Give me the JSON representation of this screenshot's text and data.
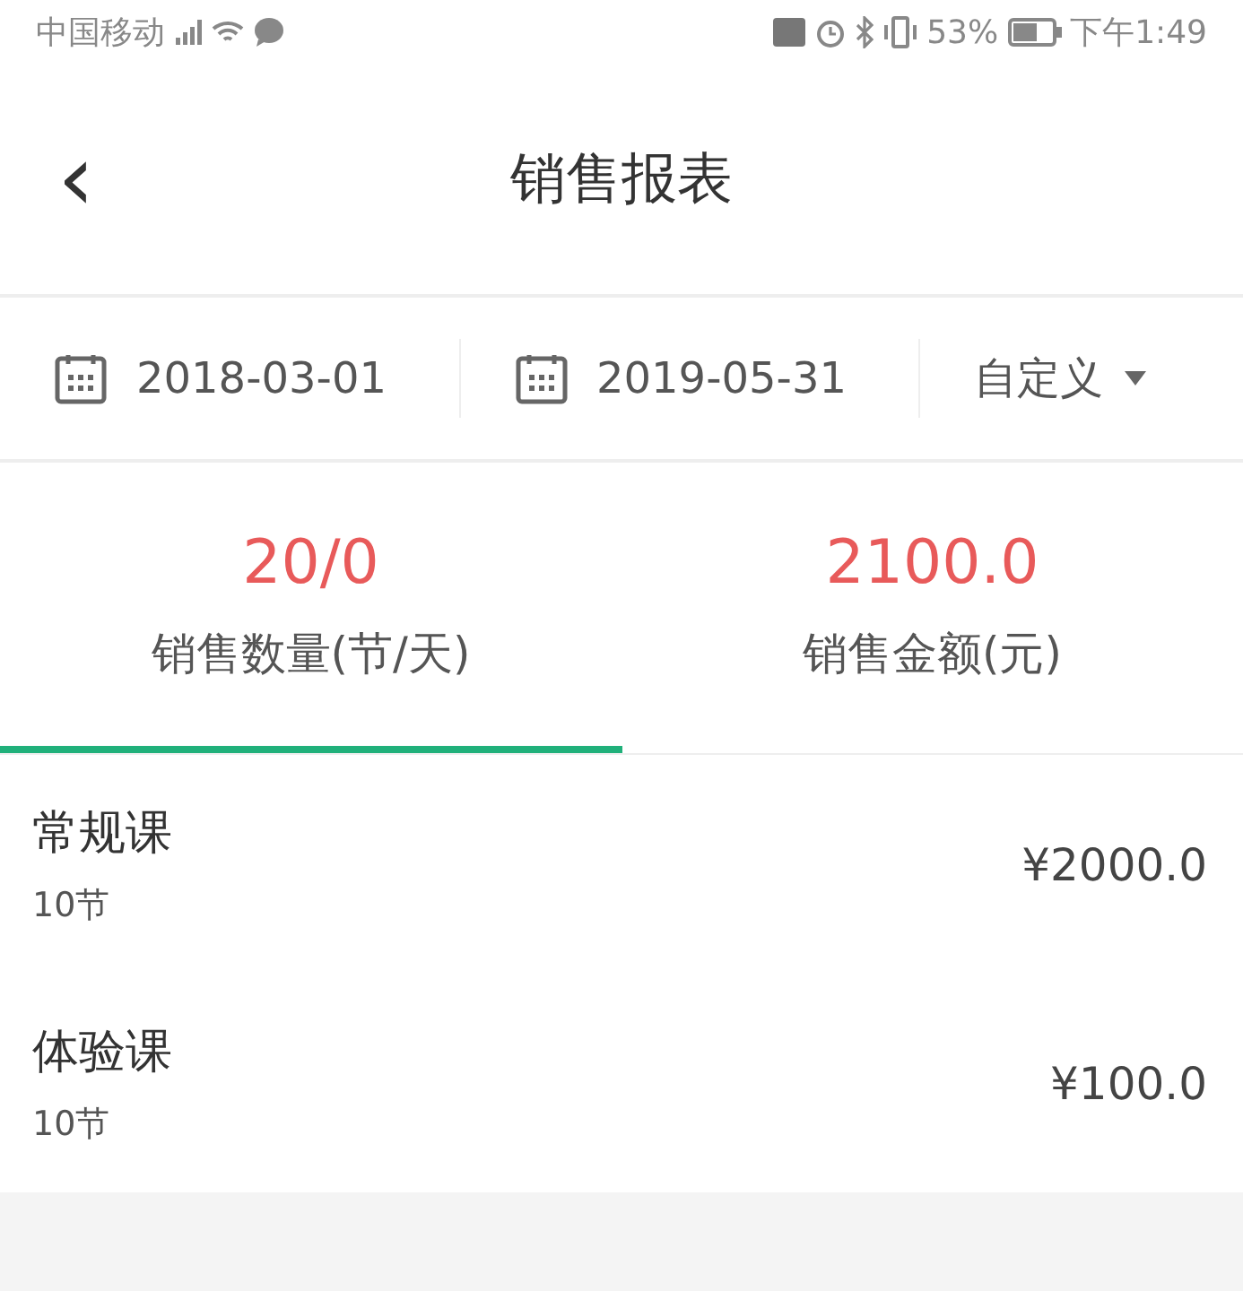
{
  "status_bar": {
    "carrier": "中国移动",
    "battery": "53%",
    "time": "下午1:49"
  },
  "header": {
    "back": "‹",
    "title": "销售报表"
  },
  "filter": {
    "start_date": "2018-03-01",
    "end_date": "2019-05-31",
    "range": "自定义"
  },
  "tabs": [
    {
      "value": "20/0",
      "label": "销售数量(节/天)",
      "selected": true
    },
    {
      "value": "2100.0",
      "label": "销售金额(元)",
      "selected": false
    }
  ],
  "items": [
    {
      "name": "常规课",
      "count": "10节",
      "amount": "¥2000.0"
    },
    {
      "name": "体验课",
      "count": "10节",
      "amount": "¥100.0"
    }
  ]
}
